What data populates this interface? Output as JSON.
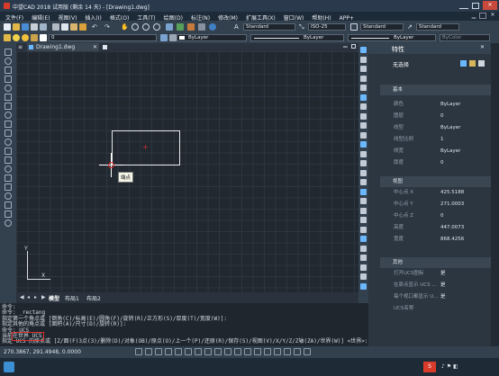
{
  "titlebar": {
    "title": "中望CAD 2018 试用版 (剩余 14 天) - [Drawing1.dwg]"
  },
  "menubar": {
    "items": [
      "文件(F)",
      "编辑(E)",
      "视图(V)",
      "插入(I)",
      "格式(O)",
      "工具(T)",
      "绘图(D)",
      "标注(N)",
      "修改(M)",
      "扩展工具(X)",
      "窗口(W)",
      "帮助(H)",
      "APP+"
    ]
  },
  "toolbar": {
    "textstyle": "Standard",
    "dimstyle": "ISO-25",
    "tablestyle": "Standard",
    "mlstyle": "Standard",
    "layer": "0",
    "bylayer1": "ByLayer",
    "bylayer2": "ByLayer",
    "bylayer3": "ByLayer",
    "bycolor": "ByColor"
  },
  "doctab": {
    "name": "Drawing1.dwg"
  },
  "canvas": {
    "tooltip": "端点"
  },
  "layout_tabs": [
    "模型",
    "布局1",
    "布局2"
  ],
  "properties": {
    "header": "特性",
    "selection": "无选择",
    "sections": {
      "general": "基本",
      "view": "视图",
      "misc": "其他"
    },
    "general": [
      {
        "k": "颜色",
        "v": "ByLayer"
      },
      {
        "k": "图层",
        "v": "0"
      },
      {
        "k": "线型",
        "v": "ByLayer"
      },
      {
        "k": "线型比例",
        "v": "1"
      },
      {
        "k": "线宽",
        "v": "ByLayer"
      },
      {
        "k": "厚度",
        "v": "0"
      }
    ],
    "view": [
      {
        "k": "中心点 X",
        "v": "425.5188"
      },
      {
        "k": "中心点 Y",
        "v": "271.0003"
      },
      {
        "k": "中心点 Z",
        "v": "0"
      },
      {
        "k": "高度",
        "v": "447.0073"
      },
      {
        "k": "宽度",
        "v": "868.4256"
      }
    ],
    "misc": [
      {
        "k": "打开UCS图标",
        "v": "是"
      },
      {
        "k": "在原点显示 UCS ...",
        "v": "是"
      },
      {
        "k": "每个视口都显示 U...",
        "v": "是"
      },
      {
        "k": "UCS名称",
        "v": ""
      }
    ]
  },
  "command": {
    "lines": [
      "命令:",
      "命令: _rectang",
      "指定第一个角点或 [倒角(C)/标高(E)/圆角(F)/旋转(R)/正方形(S)/厚度(T)/宽度(W)]:",
      "指定其他的角点或 [面积(A)/尺寸(D)/旋转(R)]:",
      "命令: UCS",
      "当前在世界 UCS.",
      "指定 UCS 的原点或 [Z/面(F)3点(3)/删除(D)/对象(OB)/原点(O)/上一个(P)/还原(R)/保存(S)/视图(V)/X/Y/Z/Z轴(ZA)/世界(W)] <世界>:"
    ]
  },
  "status": {
    "coords": "270.3867, 291.4948, 0.0000"
  },
  "colors": {
    "accent": "#2f8cd8",
    "ucs": "#d8dde3",
    "cursor": "#ffffff",
    "highlight": "#e03030"
  }
}
